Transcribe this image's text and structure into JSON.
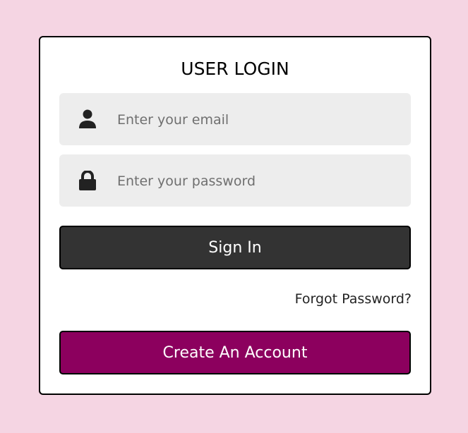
{
  "title": "USER LOGIN",
  "email": {
    "placeholder": "Enter your email",
    "icon": "user-icon"
  },
  "password": {
    "placeholder": "Enter your password",
    "icon": "lock-icon"
  },
  "sign_in": "Sign In",
  "forgot": "Forgot Password?",
  "create": "Create An Account",
  "colors": {
    "background": "#f5d5e3",
    "sign_in": "#333333",
    "create": "#8c005e"
  }
}
